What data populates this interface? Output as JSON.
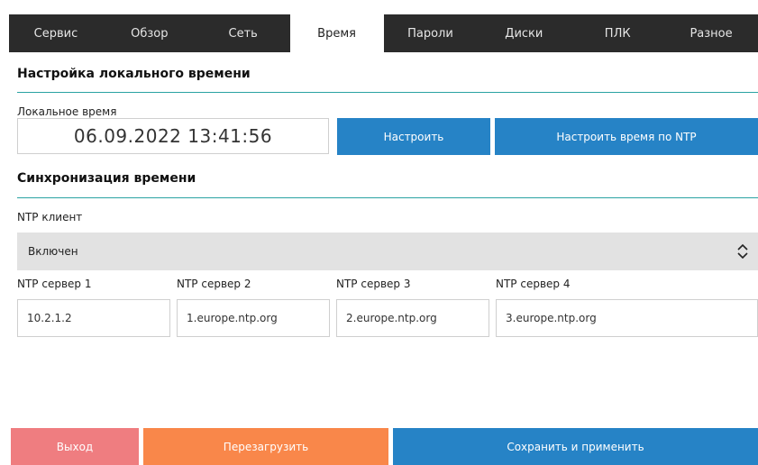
{
  "tabs": [
    {
      "label": "Сервис",
      "active": false
    },
    {
      "label": "Обзор",
      "active": false
    },
    {
      "label": "Сеть",
      "active": false
    },
    {
      "label": "Время",
      "active": true
    },
    {
      "label": "Пароли",
      "active": false
    },
    {
      "label": "Диски",
      "active": false
    },
    {
      "label": "ПЛК",
      "active": false
    },
    {
      "label": "Разное",
      "active": false
    }
  ],
  "local_time": {
    "section_title": "Настройка локального времени",
    "label": "Локальное время",
    "value": "06.09.2022 13:41:56",
    "set_button": "Настроить",
    "ntp_button": "Настроить время по NTP"
  },
  "sync": {
    "section_title": "Синхронизация времени",
    "client_label": "NTP клиент",
    "client_value": "Включен",
    "servers": [
      {
        "label": "NTP сервер 1",
        "value": "10.2.1.2"
      },
      {
        "label": "NTP сервер 2",
        "value": "1.europe.ntp.org"
      },
      {
        "label": "NTP сервер 3",
        "value": "2.europe.ntp.org"
      },
      {
        "label": "NTP сервер 4",
        "value": "3.europe.ntp.org"
      }
    ]
  },
  "footer": {
    "exit": "Выход",
    "reboot": "Перезагрузить",
    "save": "Сохранить и применить"
  },
  "colors": {
    "tab_bar": "#2b2b2b",
    "accent_blue": "#2683c6",
    "exit_red": "#ef7d80",
    "reboot_orange": "#f9874a",
    "rule_teal": "#2aa3a3"
  }
}
